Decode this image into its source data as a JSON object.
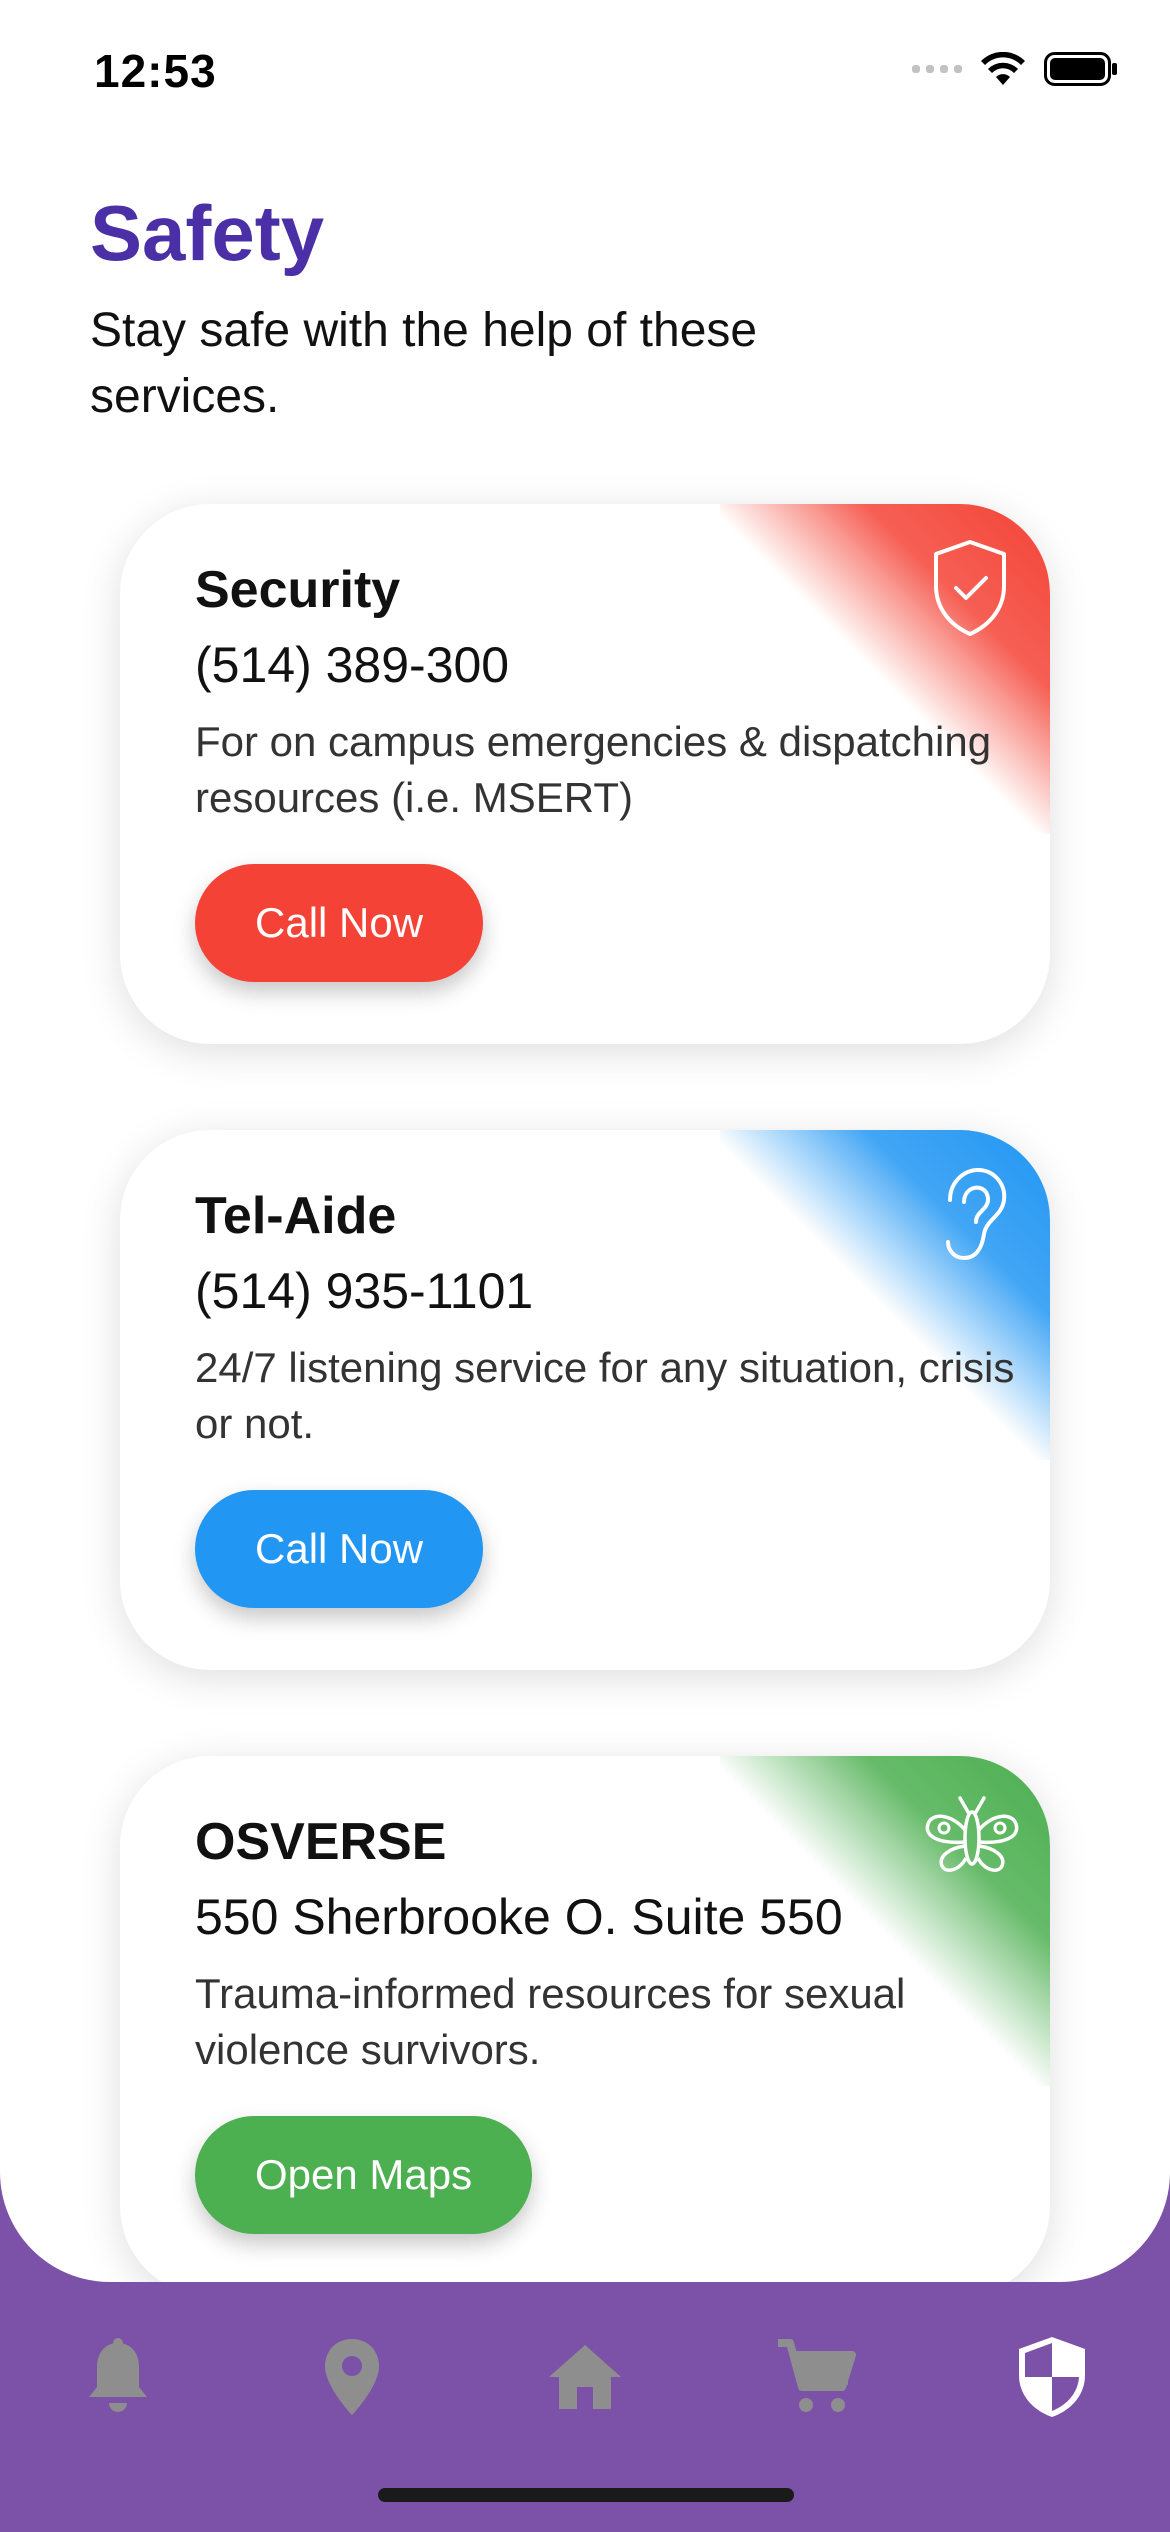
{
  "status_bar": {
    "time": "12:53"
  },
  "header": {
    "title": "Safety",
    "subtitle": "Stay safe with the help of these services."
  },
  "cards": [
    {
      "title": "Security",
      "line": "(514) 389-300",
      "description": "For on campus emergencies & dispatching resources (i.e. MSERT)",
      "button": "Call Now",
      "accent": "#F44336",
      "icon": "shield-check-icon"
    },
    {
      "title": "Tel-Aide",
      "line": "(514) 935-1101",
      "description": "24/7 listening service for any situation, crisis or not.",
      "button": "Call Now",
      "accent": "#2196F3",
      "icon": "ear-icon"
    },
    {
      "title": "OSVERSE",
      "line": "550 Sherbrooke O. Suite 550",
      "description": "Trauma-informed resources for sexual violence survivors.",
      "button": "Open Maps",
      "accent": "#4CAF50",
      "icon": "butterfly-icon"
    }
  ],
  "bottom_nav": {
    "background": "#7B52A8",
    "items": [
      {
        "icon": "bell-icon",
        "active": false
      },
      {
        "icon": "location-pin-icon",
        "active": false
      },
      {
        "icon": "home-icon",
        "active": false
      },
      {
        "icon": "cart-icon",
        "active": false
      },
      {
        "icon": "shield-icon",
        "active": true
      }
    ]
  }
}
